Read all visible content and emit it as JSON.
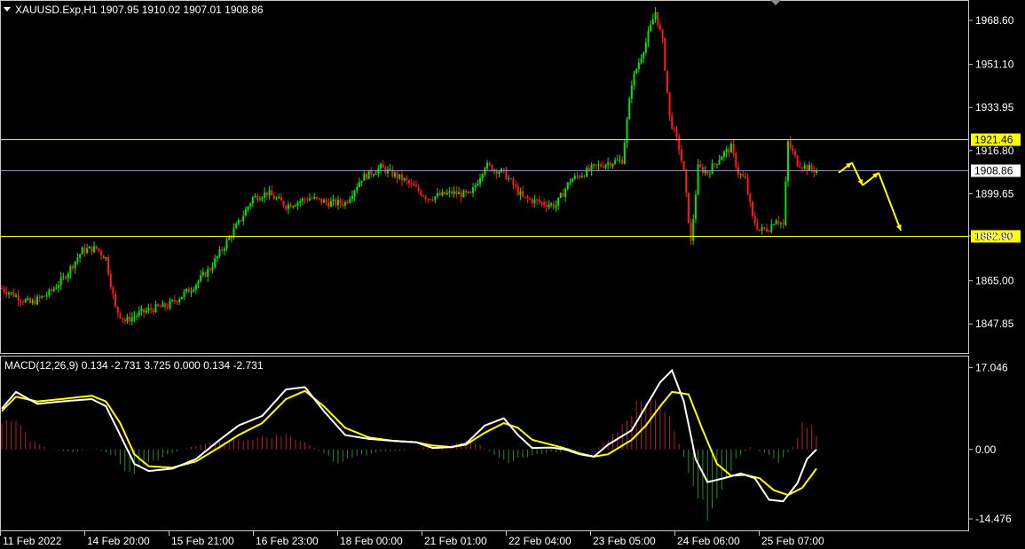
{
  "header": {
    "symbol_line": "XAUUSD.Exp,H1  1907.95 1910.02 1907.01 1908.86"
  },
  "macd": {
    "label": "MACD(12,26,9) 0.134 -2.731 3.725 0.000 0.134 -2.731"
  },
  "colors": {
    "background": "#000000",
    "bull": "#00e600",
    "bear": "#ff1a1a",
    "level_line": "#ffff00",
    "price_line": "#8c96b4",
    "macd_line": "#ffffff",
    "signal_line": "#ffff00",
    "hist_pos": "#b22222",
    "hist_neg": "#2e8b22",
    "arrow": "#ffff00"
  },
  "chart_data": [
    {
      "type": "candlestick",
      "symbol": "XAUUSD.Exp",
      "timeframe": "H1",
      "ohlc_last": {
        "open": 1907.95,
        "high": 1910.02,
        "low": 1907.01,
        "close": 1908.86
      },
      "y_ticks": [
        "1968.60",
        "1951.10",
        "1933.95",
        "1916.80",
        "1899.65",
        "1882.90",
        "1865.00",
        "1847.85"
      ],
      "ylim": [
        1837.0,
        1976.0
      ],
      "x_ticks": [
        "11 Feb 2022",
        "14 Feb 20:00",
        "15 Feb 21:00",
        "16 Feb 23:00",
        "18 Feb 00:00",
        "21 Feb 01:00",
        "22 Feb 04:00",
        "23 Feb 05:00",
        "24 Feb 06:00",
        "25 Feb 07:00"
      ],
      "levels": [
        {
          "value": 1921.46,
          "label": "1921.46"
        },
        {
          "value": 1882.9,
          "label": "1882.90"
        }
      ],
      "current_price": {
        "value": 1908.86,
        "label": "1908.86"
      },
      "close_path": [
        [
          0,
          1862
        ],
        [
          12,
          1856
        ],
        [
          20,
          1860
        ],
        [
          26,
          1866
        ],
        [
          34,
          1877
        ],
        [
          40,
          1878
        ],
        [
          44,
          1874
        ],
        [
          48,
          1854
        ],
        [
          52,
          1849
        ],
        [
          58,
          1852
        ],
        [
          64,
          1854
        ],
        [
          70,
          1855
        ],
        [
          80,
          1862
        ],
        [
          88,
          1870
        ],
        [
          94,
          1879
        ],
        [
          100,
          1888
        ],
        [
          106,
          1898
        ],
        [
          112,
          1900
        ],
        [
          120,
          1895
        ],
        [
          130,
          1898
        ],
        [
          138,
          1896
        ],
        [
          145,
          1896
        ],
        [
          152,
          1906
        ],
        [
          160,
          1910
        ],
        [
          170,
          1905
        ],
        [
          180,
          1898
        ],
        [
          190,
          1900
        ],
        [
          198,
          1899
        ],
        [
          204,
          1911
        ],
        [
          212,
          1908
        ],
        [
          220,
          1898
        ],
        [
          228,
          1896
        ],
        [
          234,
          1895
        ],
        [
          240,
          1905
        ],
        [
          250,
          1910
        ],
        [
          256,
          1912
        ],
        [
          262,
          1913
        ],
        [
          266,
          1944
        ],
        [
          272,
          1960
        ],
        [
          276,
          1972
        ],
        [
          279,
          1960
        ],
        [
          282,
          1930
        ],
        [
          286,
          1918
        ],
        [
          288,
          1908
        ],
        [
          291,
          1880
        ],
        [
          294,
          1910
        ],
        [
          298,
          1908
        ],
        [
          304,
          1915
        ],
        [
          308,
          1918
        ],
        [
          311,
          1908
        ],
        [
          314,
          1905
        ],
        [
          317,
          1890
        ],
        [
          320,
          1885
        ],
        [
          324,
          1886
        ],
        [
          327,
          1890
        ],
        [
          330,
          1887
        ],
        [
          332,
          1920
        ],
        [
          334,
          1916
        ],
        [
          336,
          1912
        ],
        [
          340,
          1910
        ],
        [
          344,
          1908.86
        ]
      ],
      "projection_arrows": [
        [
          1908,
          1912
        ],
        [
          1912,
          1903
        ],
        [
          1903,
          1908
        ],
        [
          1908,
          1885
        ]
      ]
    },
    {
      "type": "line",
      "title": "MACD(12,26,9) 0.134 -2.731 3.725 0.000 0.134 -2.731",
      "y_ticks": [
        "17.046",
        "0.00",
        "-14.476"
      ],
      "ylim": [
        -16.5,
        19.0
      ],
      "series": [
        {
          "name": "MACD",
          "values": [
            [
              0,
              8.5
            ],
            [
              6,
              12
            ],
            [
              15,
              9.5
            ],
            [
              25,
              10
            ],
            [
              38,
              10.5
            ],
            [
              44,
              9
            ],
            [
              50,
              3
            ],
            [
              56,
              -3
            ],
            [
              62,
              -4.5
            ],
            [
              72,
              -4
            ],
            [
              82,
              -2
            ],
            [
              92,
              2
            ],
            [
              100,
              5
            ],
            [
              110,
              7
            ],
            [
              120,
              12.5
            ],
            [
              128,
              13
            ],
            [
              136,
              8
            ],
            [
              145,
              3
            ],
            [
              155,
              2.2
            ],
            [
              165,
              1.8
            ],
            [
              175,
              1.5
            ],
            [
              182,
              0.3
            ],
            [
              190,
              0.5
            ],
            [
              196,
              1.2
            ],
            [
              204,
              5
            ],
            [
              212,
              6.5
            ],
            [
              218,
              3
            ],
            [
              224,
              0.3
            ],
            [
              232,
              0.4
            ],
            [
              238,
              0
            ],
            [
              244,
              -1
            ],
            [
              250,
              -1.5
            ],
            [
              256,
              1
            ],
            [
              266,
              4
            ],
            [
              272,
              9
            ],
            [
              278,
              14
            ],
            [
              283,
              16.5
            ],
            [
              288,
              10
            ],
            [
              293,
              -2
            ],
            [
              298,
              -6.8
            ],
            [
              305,
              -6
            ],
            [
              312,
              -5
            ],
            [
              318,
              -6
            ],
            [
              324,
              -10.5
            ],
            [
              330,
              -10.8
            ],
            [
              336,
              -7
            ],
            [
              340,
              -2
            ],
            [
              344,
              0
            ]
          ]
        },
        {
          "name": "Signal",
          "values": [
            [
              0,
              8
            ],
            [
              6,
              11
            ],
            [
              15,
              10
            ],
            [
              25,
              10.5
            ],
            [
              38,
              11.2
            ],
            [
              44,
              10
            ],
            [
              50,
              5.5
            ],
            [
              56,
              -1
            ],
            [
              62,
              -3.5
            ],
            [
              72,
              -3.8
            ],
            [
              82,
              -2.5
            ],
            [
              92,
              0.5
            ],
            [
              100,
              3
            ],
            [
              110,
              5.5
            ],
            [
              120,
              10.5
            ],
            [
              128,
              12.2
            ],
            [
              136,
              9
            ],
            [
              145,
              4.5
            ],
            [
              155,
              2.5
            ],
            [
              165,
              1.8
            ],
            [
              175,
              1.5
            ],
            [
              182,
              0.8
            ],
            [
              190,
              0.5
            ],
            [
              196,
              1
            ],
            [
              204,
              3.5
            ],
            [
              212,
              5.5
            ],
            [
              218,
              4.5
            ],
            [
              224,
              2
            ],
            [
              232,
              1
            ],
            [
              238,
              0.2
            ],
            [
              244,
              -0.8
            ],
            [
              250,
              -1.5
            ],
            [
              256,
              -1
            ],
            [
              266,
              2
            ],
            [
              272,
              5
            ],
            [
              278,
              9
            ],
            [
              283,
              12
            ],
            [
              290,
              11.5
            ],
            [
              296,
              4
            ],
            [
              302,
              -3
            ],
            [
              308,
              -5.5
            ],
            [
              314,
              -5.3
            ],
            [
              320,
              -6
            ],
            [
              326,
              -8.5
            ],
            [
              332,
              -9.5
            ],
            [
              338,
              -8
            ],
            [
              344,
              -4
            ]
          ]
        },
        {
          "name": "Histogram",
          "values": [
            [
              0,
              5
            ],
            [
              6,
              6
            ],
            [
              12,
              2
            ],
            [
              20,
              0
            ],
            [
              30,
              -0.5
            ],
            [
              40,
              0.2
            ],
            [
              48,
              -1.5
            ],
            [
              54,
              -5.5
            ],
            [
              60,
              -3.5
            ],
            [
              70,
              -1
            ],
            [
              80,
              0.5
            ],
            [
              90,
              1.5
            ],
            [
              100,
              2
            ],
            [
              110,
              2.5
            ],
            [
              120,
              3
            ],
            [
              128,
              1.5
            ],
            [
              136,
              -0.8
            ],
            [
              142,
              -3
            ],
            [
              150,
              -1.5
            ],
            [
              160,
              -0.5
            ],
            [
              170,
              -0.2
            ],
            [
              180,
              0.5
            ],
            [
              190,
              1.2
            ],
            [
              196,
              2
            ],
            [
              202,
              1
            ],
            [
              208,
              -1
            ],
            [
              214,
              -2.5
            ],
            [
              222,
              -1.5
            ],
            [
              232,
              -0.5
            ],
            [
              242,
              -0.5
            ],
            [
              252,
              0.5
            ],
            [
              260,
              4
            ],
            [
              268,
              9
            ],
            [
              276,
              11
            ],
            [
              282,
              7
            ],
            [
              288,
              -1.5
            ],
            [
              294,
              -11
            ],
            [
              298,
              -13.5
            ],
            [
              304,
              -8
            ],
            [
              310,
              -2
            ],
            [
              316,
              0.5
            ],
            [
              322,
              -0.8
            ],
            [
              328,
              -2.5
            ],
            [
              334,
              0.5
            ],
            [
              338,
              5
            ],
            [
              342,
              4.5
            ],
            [
              344,
              3
            ]
          ]
        }
      ]
    }
  ]
}
